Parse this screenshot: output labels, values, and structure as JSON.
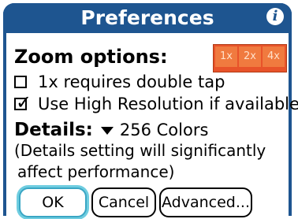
{
  "window": {
    "title": "Preferences",
    "info_icon": "info-icon",
    "title_color": "#1e5590"
  },
  "zoom": {
    "label": "Zoom options:",
    "options": [
      "1x",
      "2x",
      "4x"
    ],
    "accent_color": "#e8532a"
  },
  "checkboxes": [
    {
      "label": "1x requires double tap",
      "checked": false
    },
    {
      "label": "Use High Resolution if available",
      "checked": true
    }
  ],
  "details": {
    "label": "Details:",
    "value": "256 Colors",
    "note_line1": "(Details setting will significantly",
    "note_line2": "affect performance)"
  },
  "buttons": {
    "ok": "OK",
    "cancel": "Cancel",
    "advanced": "Advanced..."
  }
}
